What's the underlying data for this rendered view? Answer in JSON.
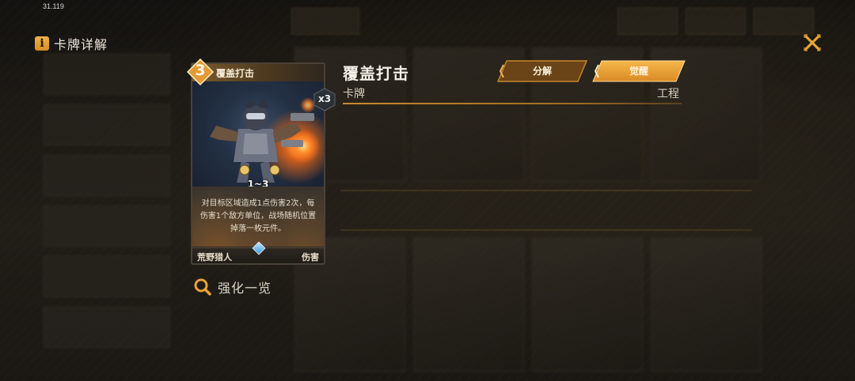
{
  "status_bar": {
    "time": "31.119"
  },
  "header": {
    "title": "卡牌详解"
  },
  "card": {
    "cost": "3",
    "name": "覆盖打击",
    "count": "x3",
    "range": "1~3",
    "description": "对目标区域造成1点伤害2次，每伤害1个敌方单位，战场随机位置掉落一枚元件。",
    "faction": "荒野猎人",
    "kind": "伤害"
  },
  "detail": {
    "name": "覆盖打击",
    "type": "卡牌",
    "faction": "工程"
  },
  "actions": {
    "dismantle_label": "分解",
    "awaken_label": "觉醒"
  },
  "enhance": {
    "label": "强化一览"
  },
  "icons": {
    "info": "info-icon",
    "close": "close-icon",
    "search": "search-icon"
  },
  "colors": {
    "accent": "#e9a33a",
    "accent_dark": "#7a4d14",
    "background": "#1e1c19"
  }
}
